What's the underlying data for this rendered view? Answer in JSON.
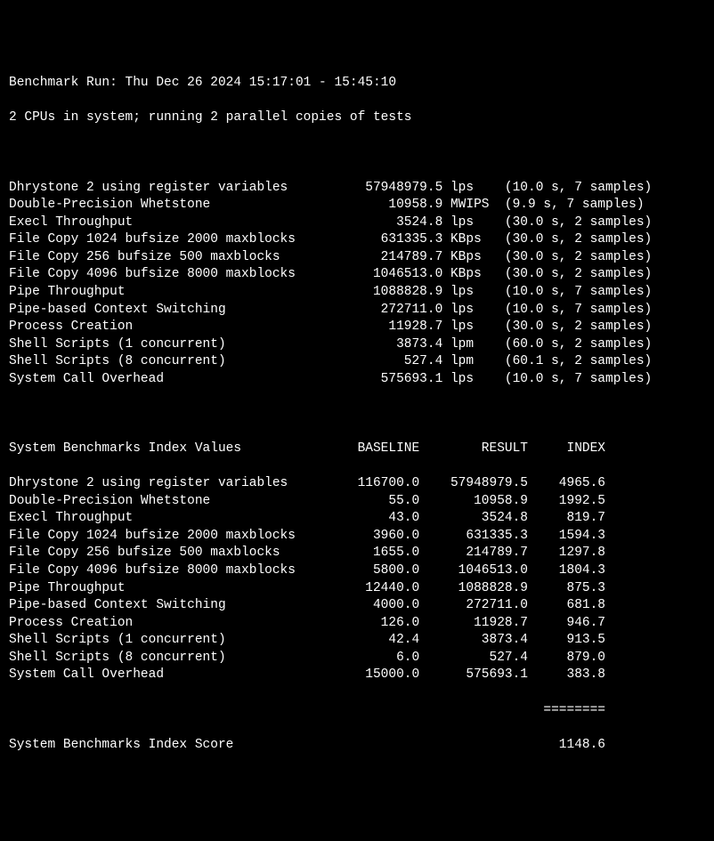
{
  "header": {
    "run_line": "Benchmark Run: Thu Dec 26 2024 15:17:01 - 15:45:10",
    "cpu_line": "2 CPUs in system; running 2 parallel copies of tests"
  },
  "tests": [
    {
      "name": "Dhrystone 2 using register variables",
      "value": "57948979.5",
      "unit": "lps",
      "time": "10.0",
      "samples": "7"
    },
    {
      "name": "Double-Precision Whetstone",
      "value": "10958.9",
      "unit": "MWIPS",
      "time": "9.9",
      "samples": "7"
    },
    {
      "name": "Execl Throughput",
      "value": "3524.8",
      "unit": "lps",
      "time": "30.0",
      "samples": "2"
    },
    {
      "name": "File Copy 1024 bufsize 2000 maxblocks",
      "value": "631335.3",
      "unit": "KBps",
      "time": "30.0",
      "samples": "2"
    },
    {
      "name": "File Copy 256 bufsize 500 maxblocks",
      "value": "214789.7",
      "unit": "KBps",
      "time": "30.0",
      "samples": "2"
    },
    {
      "name": "File Copy 4096 bufsize 8000 maxblocks",
      "value": "1046513.0",
      "unit": "KBps",
      "time": "30.0",
      "samples": "2"
    },
    {
      "name": "Pipe Throughput",
      "value": "1088828.9",
      "unit": "lps",
      "time": "10.0",
      "samples": "7"
    },
    {
      "name": "Pipe-based Context Switching",
      "value": "272711.0",
      "unit": "lps",
      "time": "10.0",
      "samples": "7"
    },
    {
      "name": "Process Creation",
      "value": "11928.7",
      "unit": "lps",
      "time": "30.0",
      "samples": "2"
    },
    {
      "name": "Shell Scripts (1 concurrent)",
      "value": "3873.4",
      "unit": "lpm",
      "time": "60.0",
      "samples": "2"
    },
    {
      "name": "Shell Scripts (8 concurrent)",
      "value": "527.4",
      "unit": "lpm",
      "time": "60.1",
      "samples": "2"
    },
    {
      "name": "System Call Overhead",
      "value": "575693.1",
      "unit": "lps",
      "time": "10.0",
      "samples": "7"
    }
  ],
  "index_header": {
    "title": "System Benchmarks Index Values",
    "col1": "BASELINE",
    "col2": "RESULT",
    "col3": "INDEX"
  },
  "index_rows": [
    {
      "name": "Dhrystone 2 using register variables",
      "baseline": "116700.0",
      "result": "57948979.5",
      "index": "4965.6"
    },
    {
      "name": "Double-Precision Whetstone",
      "baseline": "55.0",
      "result": "10958.9",
      "index": "1992.5"
    },
    {
      "name": "Execl Throughput",
      "baseline": "43.0",
      "result": "3524.8",
      "index": "819.7"
    },
    {
      "name": "File Copy 1024 bufsize 2000 maxblocks",
      "baseline": "3960.0",
      "result": "631335.3",
      "index": "1594.3"
    },
    {
      "name": "File Copy 256 bufsize 500 maxblocks",
      "baseline": "1655.0",
      "result": "214789.7",
      "index": "1297.8"
    },
    {
      "name": "File Copy 4096 bufsize 8000 maxblocks",
      "baseline": "5800.0",
      "result": "1046513.0",
      "index": "1804.3"
    },
    {
      "name": "Pipe Throughput",
      "baseline": "12440.0",
      "result": "1088828.9",
      "index": "875.3"
    },
    {
      "name": "Pipe-based Context Switching",
      "baseline": "4000.0",
      "result": "272711.0",
      "index": "681.8"
    },
    {
      "name": "Process Creation",
      "baseline": "126.0",
      "result": "11928.7",
      "index": "946.7"
    },
    {
      "name": "Shell Scripts (1 concurrent)",
      "baseline": "42.4",
      "result": "3873.4",
      "index": "913.5"
    },
    {
      "name": "Shell Scripts (8 concurrent)",
      "baseline": "6.0",
      "result": "527.4",
      "index": "879.0"
    },
    {
      "name": "System Call Overhead",
      "baseline": "15000.0",
      "result": "575693.1",
      "index": "383.8"
    }
  ],
  "separator": "========",
  "score": {
    "label": "System Benchmarks Index Score",
    "value": "1148.6"
  }
}
